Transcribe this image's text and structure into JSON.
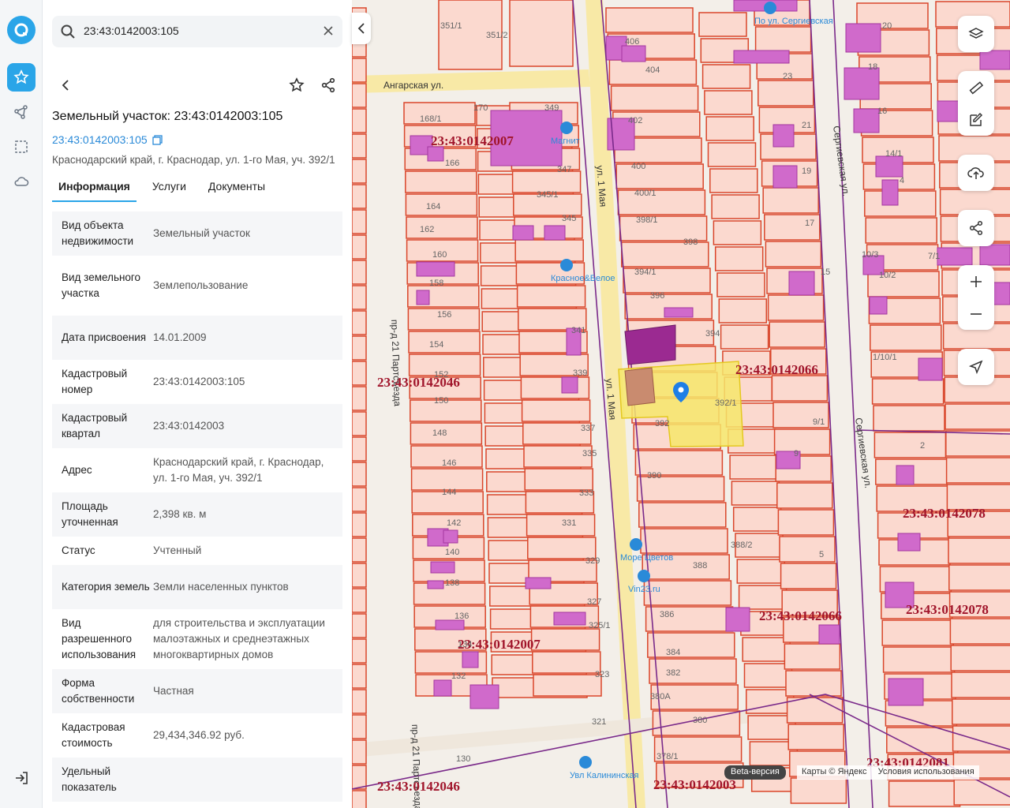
{
  "search": {
    "value": "23:43:0142003:105"
  },
  "card": {
    "title": "Земельный участок: 23:43:0142003:105",
    "cad_link": "23:43:0142003:105",
    "address": "Краснодарский край, г. Краснодар, ул. 1-го Мая, уч. 392/1"
  },
  "tabs": [
    "Информация",
    "Услуги",
    "Документы"
  ],
  "rows": [
    {
      "k": "Вид объекта недвижимости",
      "v": "Земельный участок"
    },
    {
      "k": "Вид земельного участка",
      "v": "Землепользование"
    },
    {
      "k": "Дата присвоения",
      "v": "14.01.2009"
    },
    {
      "k": "Кадастровый номер",
      "v": "23:43:0142003:105"
    },
    {
      "k": "Кадастровый квартал",
      "v": "23:43:0142003"
    },
    {
      "k": "Адрес",
      "v": "Краснодарский край, г. Краснодар, ул. 1-го Мая, уч. 392/1"
    },
    {
      "k": "Площадь уточненная",
      "v": "2,398 кв. м"
    },
    {
      "k": "Статус",
      "v": "Учтенный"
    },
    {
      "k": "Категория земель",
      "v": "Земли населенных пунктов"
    },
    {
      "k": "Вид разрешенного использования",
      "v": "для строительства и эксплуатации малоэтажных и среднеэтажных многоквартирных домов"
    },
    {
      "k": "Форма собственности",
      "v": "Частная"
    },
    {
      "k": "Кадастровая стоимость",
      "v": "29,434,346.92 руб."
    },
    {
      "k": "Удельный показатель",
      "v": ""
    }
  ],
  "map": {
    "streets": {
      "angarskaya": "Ангарская ул.",
      "pervogo_maya": "ул. 1 Мая",
      "sergievskaya": "Сергиевская ул.",
      "partsyezda": "пр-д 21 Партсъезда"
    },
    "quarters": [
      "23:43:0142007",
      "23:43:0142046",
      "23:43:0142066",
      "23:43:0142078",
      "23:43:0142003",
      "23:43:0142081"
    ],
    "pois": [
      "Магнит",
      "Красное&Белое",
      "Море Цветов",
      "Vin23.ru",
      "По ул. Сергиевская",
      "Увл Калининская"
    ],
    "lot_numbers": [
      "351/1",
      "351/2",
      "406",
      "404",
      "23",
      "402",
      "400",
      "400/1",
      "398/1",
      "398",
      "394/1",
      "396",
      "394",
      "392/1",
      "392",
      "390",
      "388/2",
      "388",
      "386",
      "384",
      "382",
      "380А",
      "380",
      "378/1",
      "170",
      "168/1",
      "166",
      "164",
      "162",
      "160",
      "158",
      "156",
      "154",
      "152",
      "150",
      "148",
      "146",
      "144",
      "142",
      "140",
      "138",
      "136",
      "134",
      "132",
      "130",
      "349",
      "347",
      "345/1",
      "345",
      "341",
      "339",
      "337",
      "335",
      "333",
      "331",
      "329",
      "327",
      "325/1",
      "323",
      "321",
      "21",
      "19",
      "17",
      "15",
      "9",
      "5",
      "20",
      "18",
      "16",
      "14/1",
      "4",
      "10/3",
      "10/2",
      "1/10/1",
      "7/1",
      "9/1",
      "2"
    ],
    "beta": "Beta-версия",
    "copyright": "Карты © Яндекс",
    "terms": "Условия использования"
  },
  "colors": {
    "accent": "#2aa5e8",
    "parcel_fill": "#fbd9cf",
    "parcel_stroke": "#d9462b",
    "building": "#d06acb",
    "selected": "#f6e66b",
    "quarter_line": "#7a2a8a"
  }
}
